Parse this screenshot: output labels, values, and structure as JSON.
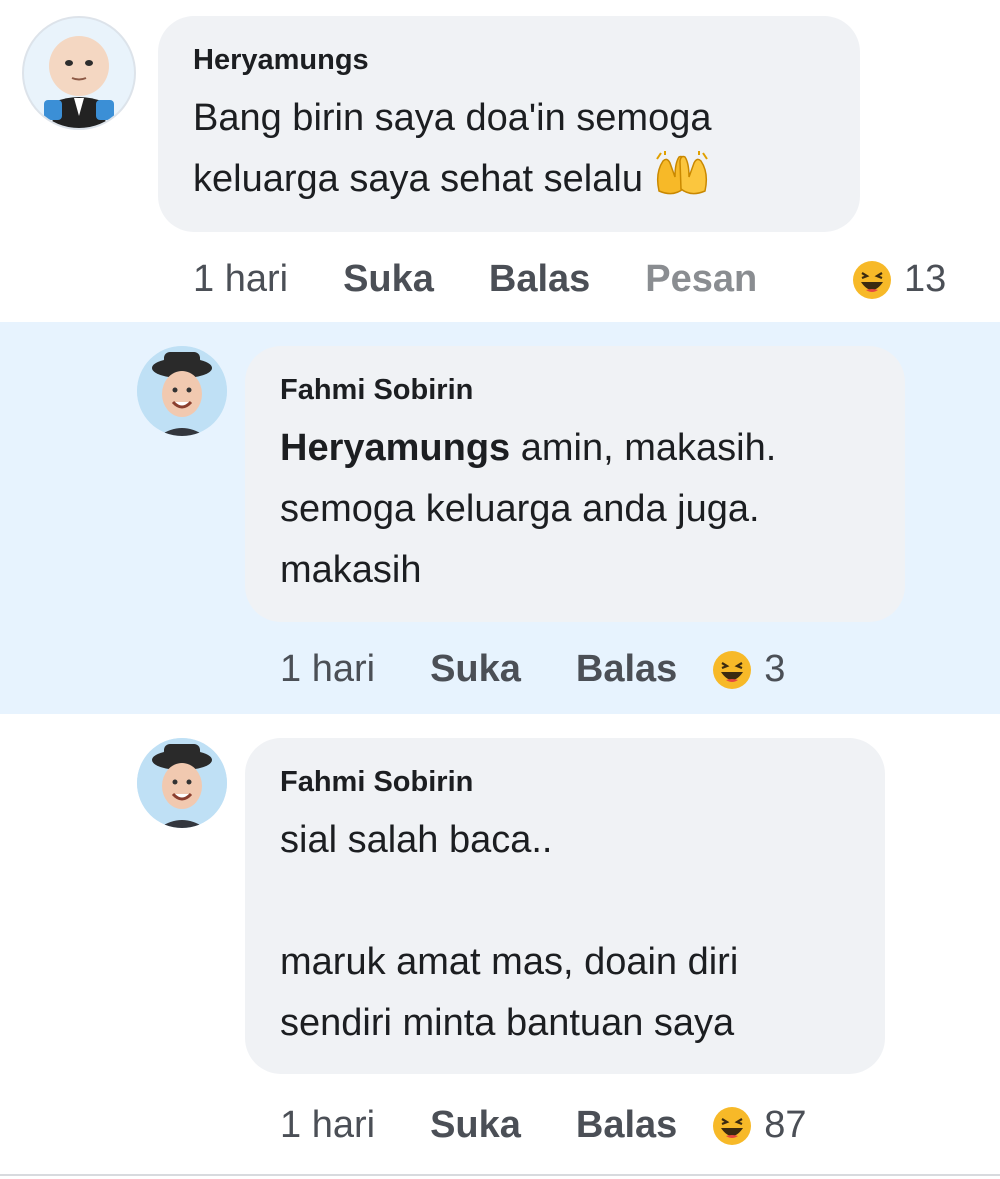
{
  "comments": [
    {
      "author": "Heryamungs",
      "lines": [
        "Bang birin saya doa'in semoga",
        "keluarga saya sehat selalu"
      ],
      "emoji_icon": "raising-hands-emoji",
      "time": "1 hari",
      "like_label": "Suka",
      "reply_label": "Balas",
      "message_label": "Pesan",
      "reaction_icon": "haha-reaction",
      "reaction_count": "13"
    },
    {
      "author": "Fahmi Sobirin",
      "mention": "Heryamungs",
      "lines": [
        " amin, makasih.",
        "semoga keluarga anda juga.",
        "makasih"
      ],
      "time": "1 hari",
      "like_label": "Suka",
      "reply_label": "Balas",
      "reaction_icon": "haha-reaction",
      "reaction_count": "3"
    },
    {
      "author": "Fahmi Sobirin",
      "lines": [
        "sial salah baca..",
        "",
        "maruk amat mas, doain diri",
        "sendiri minta bantuan saya"
      ],
      "time": "1 hari",
      "like_label": "Suka",
      "reply_label": "Balas",
      "reaction_icon": "haha-reaction",
      "reaction_count": "87"
    }
  ],
  "colors": {
    "highlight_bg": "#e7f3fe",
    "bubble_bg": "#f0f2f5",
    "haha_yellow": "#f7b928"
  }
}
